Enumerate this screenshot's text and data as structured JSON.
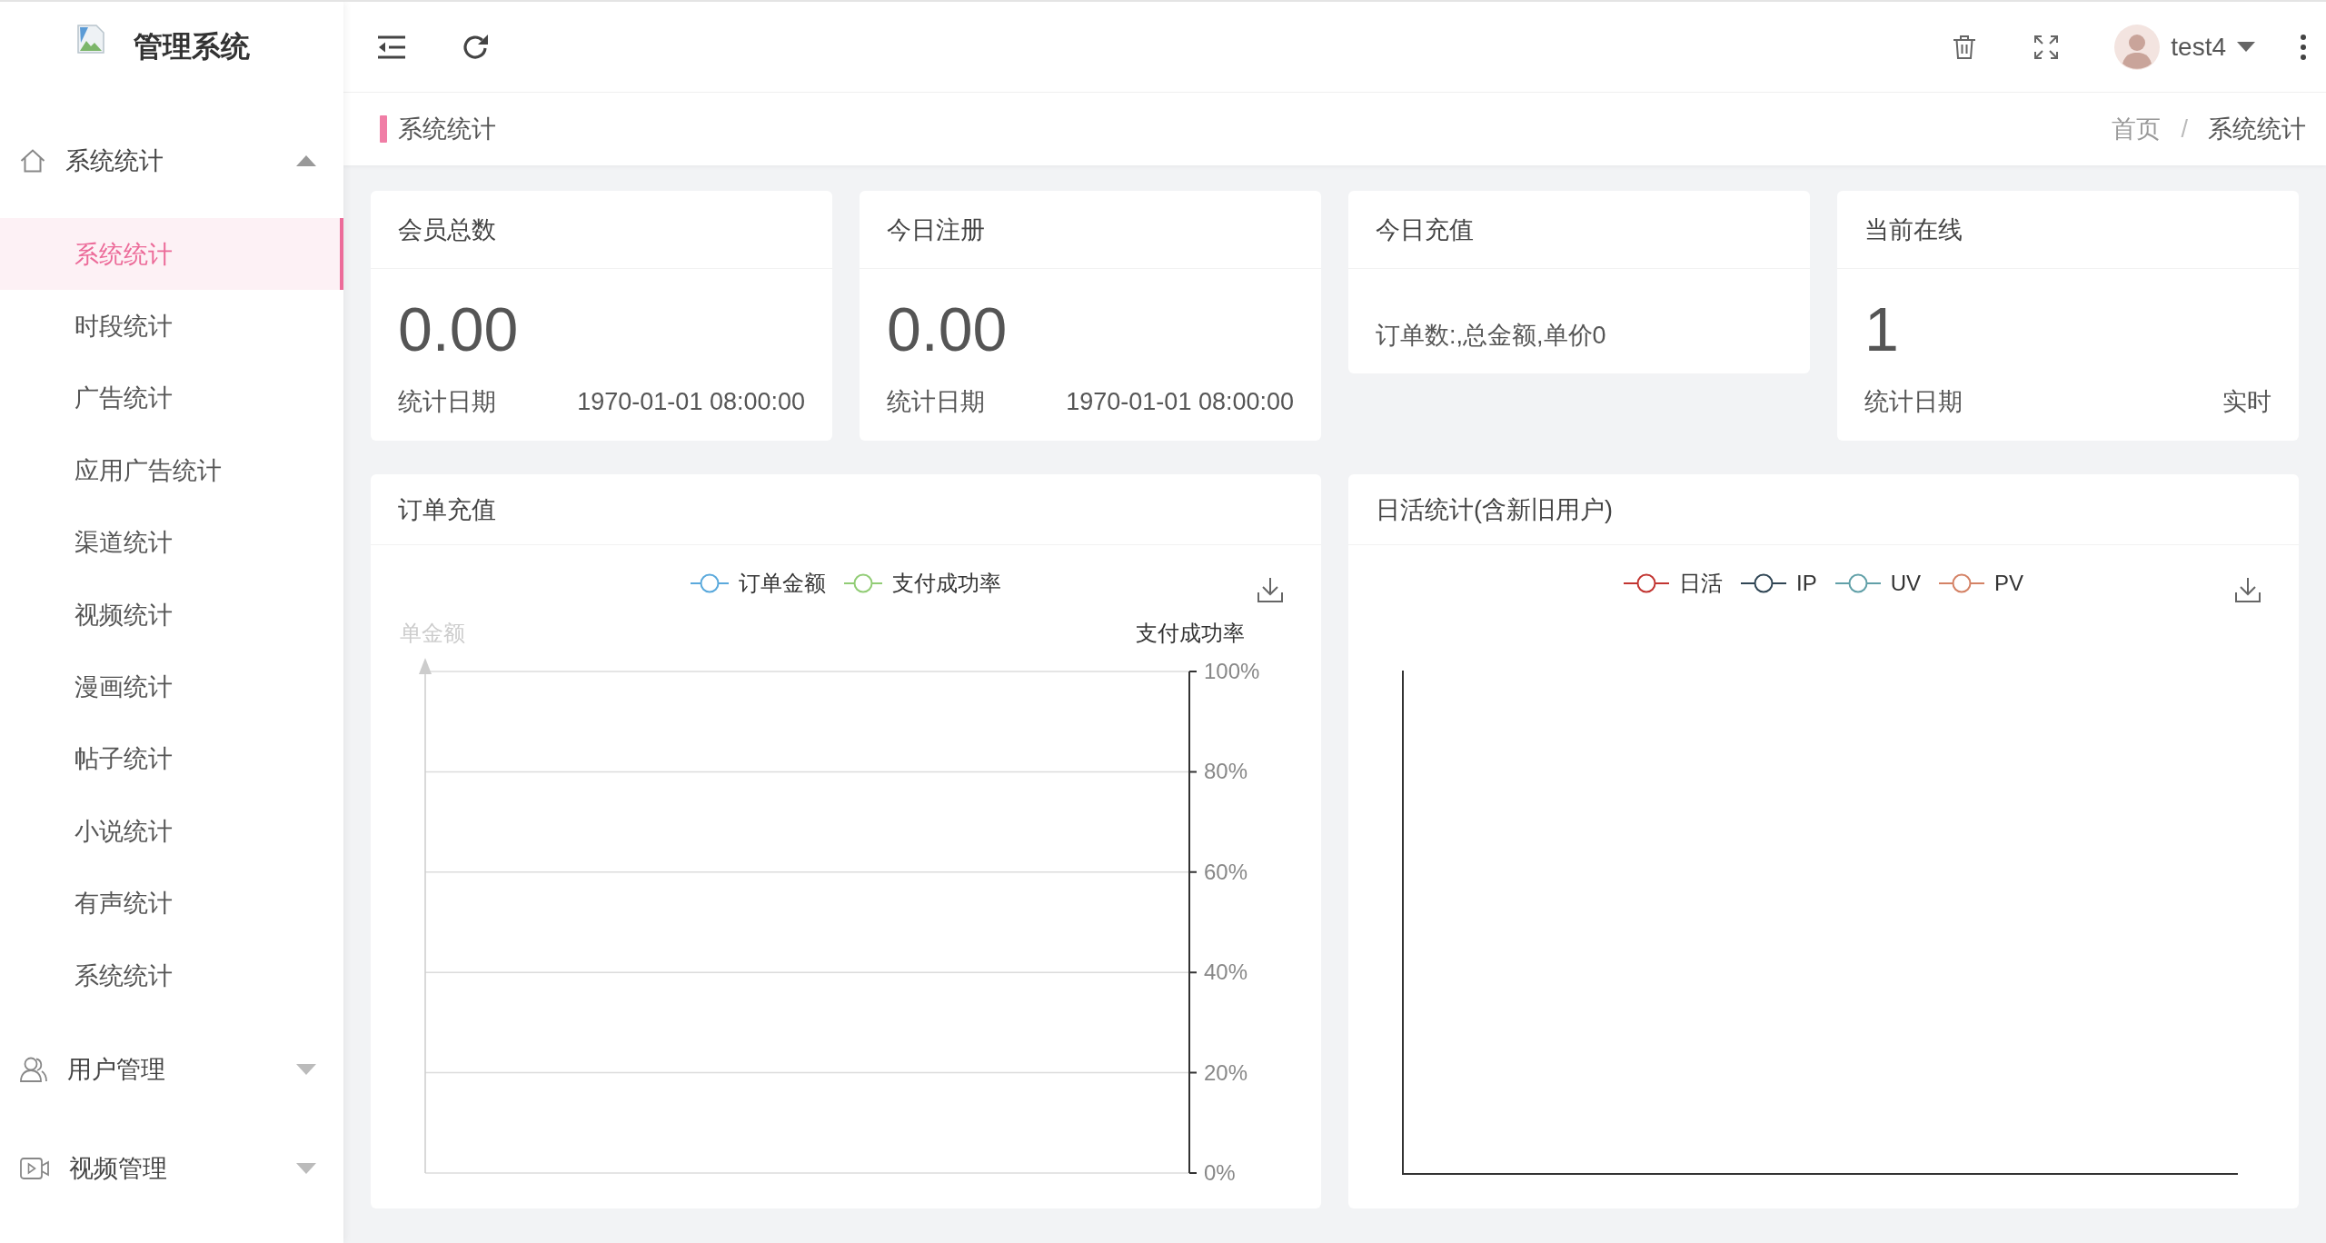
{
  "sidebar": {
    "title": "管理系统",
    "menu": [
      {
        "label": "系统统计",
        "expanded": true,
        "children": [
          {
            "label": "系统统计",
            "selected": true
          },
          {
            "label": "时段统计",
            "selected": false
          },
          {
            "label": "广告统计",
            "selected": false
          },
          {
            "label": "应用广告统计",
            "selected": false
          },
          {
            "label": "渠道统计",
            "selected": false
          },
          {
            "label": "视频统计",
            "selected": false
          },
          {
            "label": "漫画统计",
            "selected": false
          },
          {
            "label": "帖子统计",
            "selected": false
          },
          {
            "label": "小说统计",
            "selected": false
          },
          {
            "label": "有声统计",
            "selected": false
          },
          {
            "label": "系统统计",
            "selected": false
          }
        ]
      },
      {
        "label": "用户管理",
        "expanded": false
      },
      {
        "label": "视频管理",
        "expanded": false
      }
    ]
  },
  "header": {
    "username": "test4"
  },
  "page_bar": {
    "title": "系统统计",
    "breadcrumb": [
      {
        "label": "首页",
        "current": false
      },
      {
        "label": "系统统计",
        "current": true
      }
    ],
    "separator": "/"
  },
  "stat_cards": [
    {
      "kind": "value",
      "title": "会员总数",
      "value": "0.00",
      "date_label": "统计日期",
      "date": "1970-01-01 08:00:00"
    },
    {
      "kind": "value",
      "title": "今日注册",
      "value": "0.00",
      "date_label": "统计日期",
      "date": "1970-01-01 08:00:00"
    },
    {
      "kind": "summary",
      "title": "今日充值",
      "text": "订单数:,总金额,单价0"
    },
    {
      "kind": "value",
      "title": "当前在线",
      "value": "1",
      "date_label": "统计日期",
      "date": "实时"
    }
  ],
  "charts": [
    {
      "title": "订单充值",
      "left_axis_title": "单金额",
      "chart_data": {
        "type": "line",
        "ylabel": "支付成功率",
        "grid": true,
        "series": [
          {
            "name": "订单金额",
            "color": "#5aa9dc"
          },
          {
            "name": "支付成功率",
            "color": "#91cc75"
          }
        ],
        "ylim": [
          0,
          100
        ],
        "yticks": [
          {
            "value": 0,
            "label": "0%"
          },
          {
            "value": 20,
            "label": "20%"
          },
          {
            "value": 40,
            "label": "40%"
          },
          {
            "value": 60,
            "label": "60%"
          },
          {
            "value": 80,
            "label": "80%"
          },
          {
            "value": 100,
            "label": "100%"
          }
        ]
      }
    },
    {
      "title": "日活统计(含新旧用户)",
      "legend": [
        {
          "label": "日活",
          "color": "#c23531"
        },
        {
          "label": "IP",
          "color": "#2f4554"
        },
        {
          "label": "UV",
          "color": "#61a0a8"
        },
        {
          "label": "PV",
          "color": "#d48265"
        }
      ]
    }
  ]
}
